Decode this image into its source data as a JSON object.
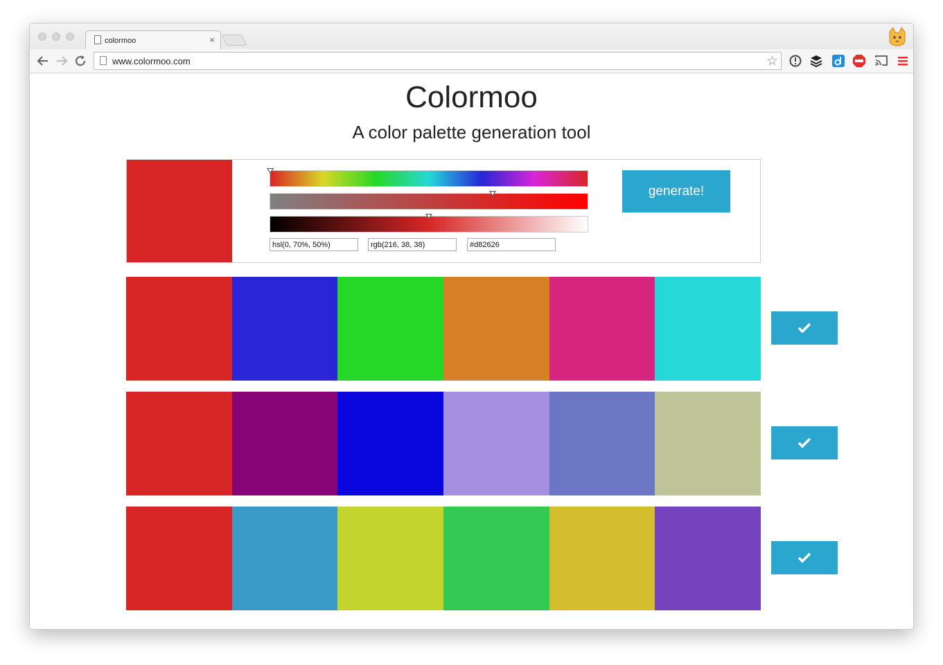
{
  "browser": {
    "tab_title": "colormoo",
    "tab_close": "×",
    "url": "www.colormoo.com"
  },
  "page": {
    "title": "Colormoo",
    "subtitle": "A color palette generation tool"
  },
  "picker": {
    "current_color": "#d82626",
    "hue_level": 0.0,
    "saturation_level": 0.7,
    "lightness_level": 0.5,
    "hsl_value": "hsl(0, 70%, 50%)",
    "rgb_value": "rgb(216, 38, 38)",
    "hex_value": "#d82626",
    "generate_label": "generate!"
  },
  "palettes": [
    {
      "colors": [
        "#d82626",
        "#2a26d8",
        "#26d826",
        "#d88026",
        "#d8267e",
        "#26d8d8"
      ]
    },
    {
      "colors": [
        "#d82626",
        "#870477",
        "#0a06de",
        "#a58fe0",
        "#6b77c5",
        "#bfc498"
      ]
    },
    {
      "colors": [
        "#d82626",
        "#3a9bc7",
        "#c2d42e",
        "#33c952",
        "#d5be2c",
        "#7443bd"
      ]
    }
  ],
  "accent_color": "#2ba6cf",
  "icons": {
    "back": "arrow-left-icon",
    "forward": "arrow-right-icon",
    "reload": "reload-icon",
    "select": "checkmark-icon"
  }
}
